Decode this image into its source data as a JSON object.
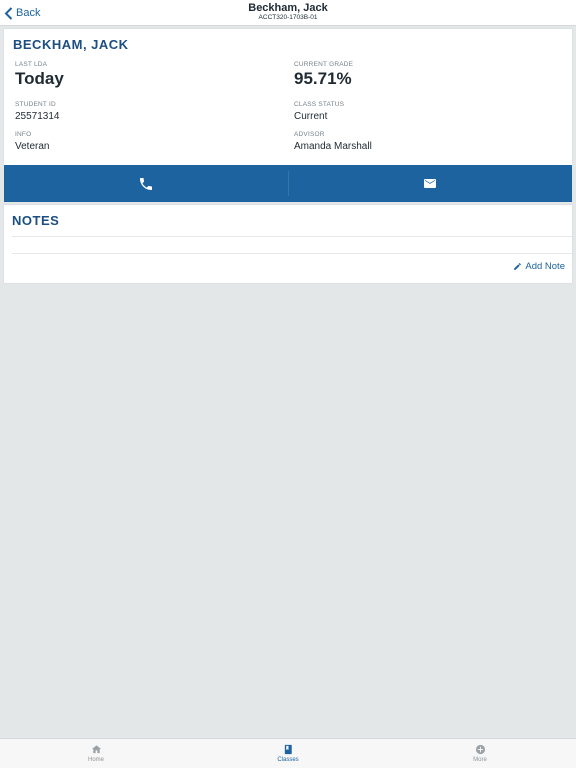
{
  "nav": {
    "back_label": "Back",
    "title": "Beckham, Jack",
    "subtitle": "ACCT320-1703B-01"
  },
  "student": {
    "name": "BECKHAM, JACK",
    "last_lda_label": "LAST LDA",
    "last_lda_value": "Today",
    "current_grade_label": "CURRENT GRADE",
    "current_grade_value": "95.71%",
    "student_id_label": "STUDENT ID",
    "student_id_value": "25571314",
    "class_status_label": "CLASS STATUS",
    "class_status_value": "Current",
    "info_label": "INFO",
    "info_value": "Veteran",
    "advisor_label": "ADVISOR",
    "advisor_value": "Amanda Marshall"
  },
  "actions": {
    "phone_icon": "phone-icon",
    "email_icon": "mail-icon"
  },
  "notes": {
    "title": "NOTES",
    "add_note_label": "Add Note"
  },
  "tabbar": {
    "items": [
      {
        "label": "Home",
        "icon": "home-icon",
        "active": false
      },
      {
        "label": "Classes",
        "icon": "book-icon",
        "active": true
      },
      {
        "label": "More",
        "icon": "more-icon",
        "active": false
      }
    ]
  },
  "colors": {
    "accent": "#1c63a0",
    "heading": "#1c4f80",
    "background": "#e3e7e8"
  }
}
